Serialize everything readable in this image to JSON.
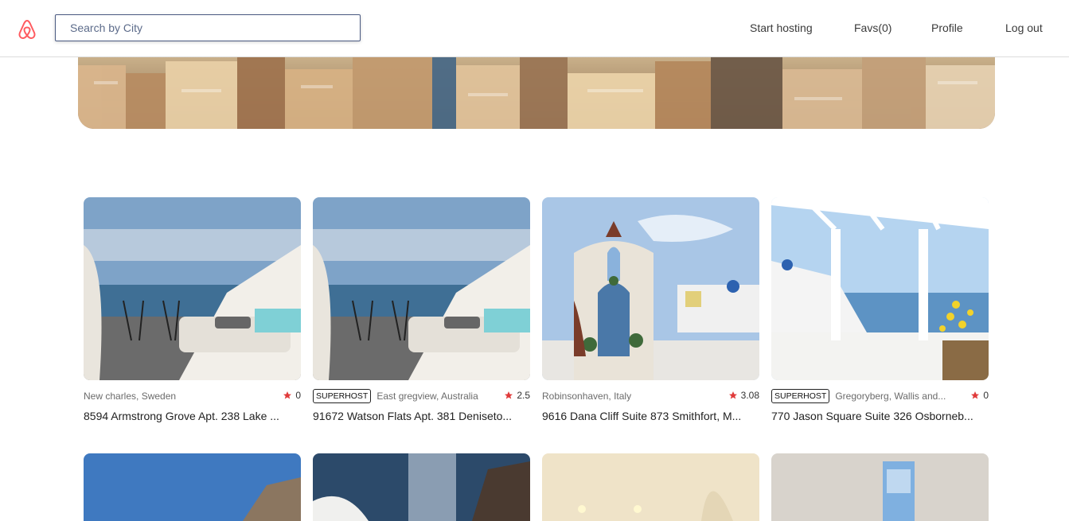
{
  "header": {
    "logo_icon": "airbnb-logo-icon",
    "search_placeholder": "Search by City",
    "nav": {
      "start_hosting": "Start hosting",
      "favs": "Favs(0)",
      "profile": "Profile",
      "logout": "Log out"
    }
  },
  "colors": {
    "brand": "#ff5a5f",
    "star": "#e03a3a"
  },
  "listings": [
    {
      "superhost": "",
      "location": "New charles, Sweden",
      "rating": "0",
      "address": "8594 Armstrong Grove Apt. 238 Lake ..."
    },
    {
      "superhost": "SUPERHOST",
      "location": "East gregview, Australia",
      "rating": "2.5",
      "address": "91672 Watson Flats Apt. 381 Deniseto..."
    },
    {
      "superhost": "",
      "location": "Robinsonhaven, Italy",
      "rating": "3.08",
      "address": "9616 Dana Cliff Suite 873 Smithfort, M..."
    },
    {
      "superhost": "SUPERHOST",
      "location": "Gregoryberg, Wallis and...",
      "rating": "0",
      "address": "770 Jason Square Suite 326 Osborneb..."
    }
  ]
}
